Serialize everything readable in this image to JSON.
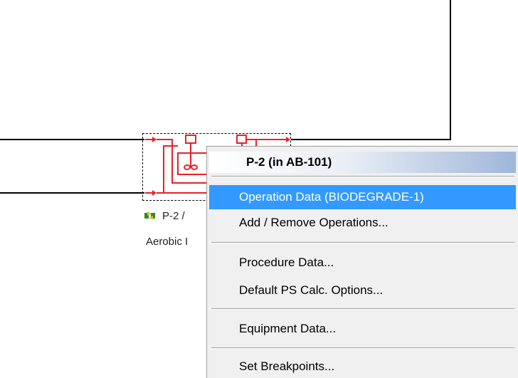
{
  "canvas": {
    "unit_label": "P-2 /",
    "unit_description": "Aerobic I"
  },
  "context_menu": {
    "header": "P-2 (in AB-101)",
    "items": [
      {
        "label": "Operation Data (BIODEGRADE-1)",
        "highlighted": true
      },
      {
        "label": "Add / Remove Operations..."
      },
      {
        "label": "Procedure Data..."
      },
      {
        "label": "Default PS Calc. Options..."
      },
      {
        "label": "Equipment Data..."
      },
      {
        "label": "Set Breakpoints..."
      }
    ]
  },
  "colors": {
    "highlight": "#3399ff",
    "unit_symbol": "#e8202a",
    "unit_icon": "#2e8b2e"
  }
}
